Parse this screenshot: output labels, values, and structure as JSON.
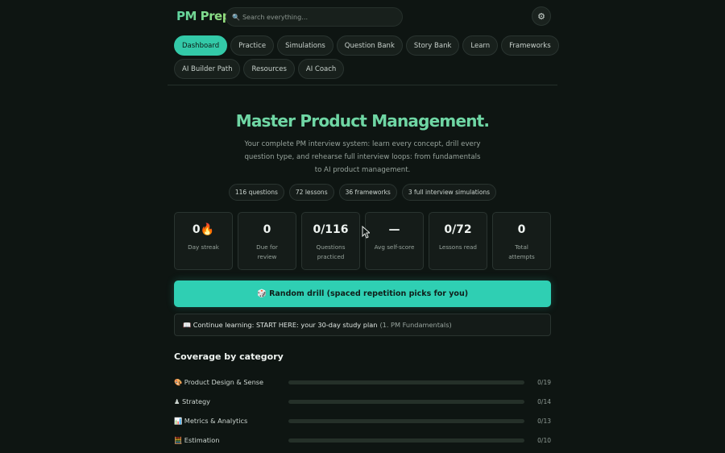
{
  "header": {
    "brand": "PM Prep",
    "search_placeholder": "Search everything…",
    "search_icon": "magnifier-icon",
    "settings_icon": "gear-icon"
  },
  "nav": {
    "row1": [
      "Dashboard",
      "Practice",
      "Simulations",
      "Question Bank",
      "Story Bank",
      "Learn",
      "Frameworks"
    ],
    "row2": [
      "AI Builder Path",
      "Resources",
      "AI Coach"
    ],
    "active": "Dashboard"
  },
  "hero": {
    "title": "Master Product Management",
    "title_dot": ".",
    "subtitle": "Your complete PM interview system: learn every concept, drill every question type, and rehearse full interview loops: from fundamentals to AI product management."
  },
  "chips": [
    "116 questions",
    "72 lessons",
    "36 frameworks",
    "3 full interview simulations"
  ],
  "stats": [
    {
      "num": "0🔥",
      "label": "Day streak"
    },
    {
      "num": "0",
      "label": "Due for review"
    },
    {
      "num": "0/116",
      "label": "Questions practiced"
    },
    {
      "num": "—",
      "label": "Avg self-score"
    },
    {
      "num": "0/72",
      "label": "Lessons read"
    },
    {
      "num": "0",
      "label": "Total attempts"
    }
  ],
  "drill_button": "🎲 Random drill (spaced repetition picks for you)",
  "continue": {
    "text": "📖 Continue learning: START HERE: your 30-day study plan",
    "paren": "(1. PM Fundamentals)"
  },
  "coverage": {
    "title": "Coverage by category",
    "items": [
      {
        "name": "🎨 Product Design & Sense",
        "value": "0/19",
        "fraction": 0
      },
      {
        "name": "♟ Strategy",
        "value": "0/14",
        "fraction": 0
      },
      {
        "name": "📊 Metrics & Analytics",
        "value": "0/13",
        "fraction": 0
      },
      {
        "name": "🧮 Estimation",
        "value": "0/10",
        "fraction": 0
      }
    ]
  },
  "colors": {
    "accent": "#33c9a8",
    "background": "#0e1512",
    "brand_gradient_start": "#5fd3a0",
    "brand_gradient_end": "#9be07a"
  }
}
